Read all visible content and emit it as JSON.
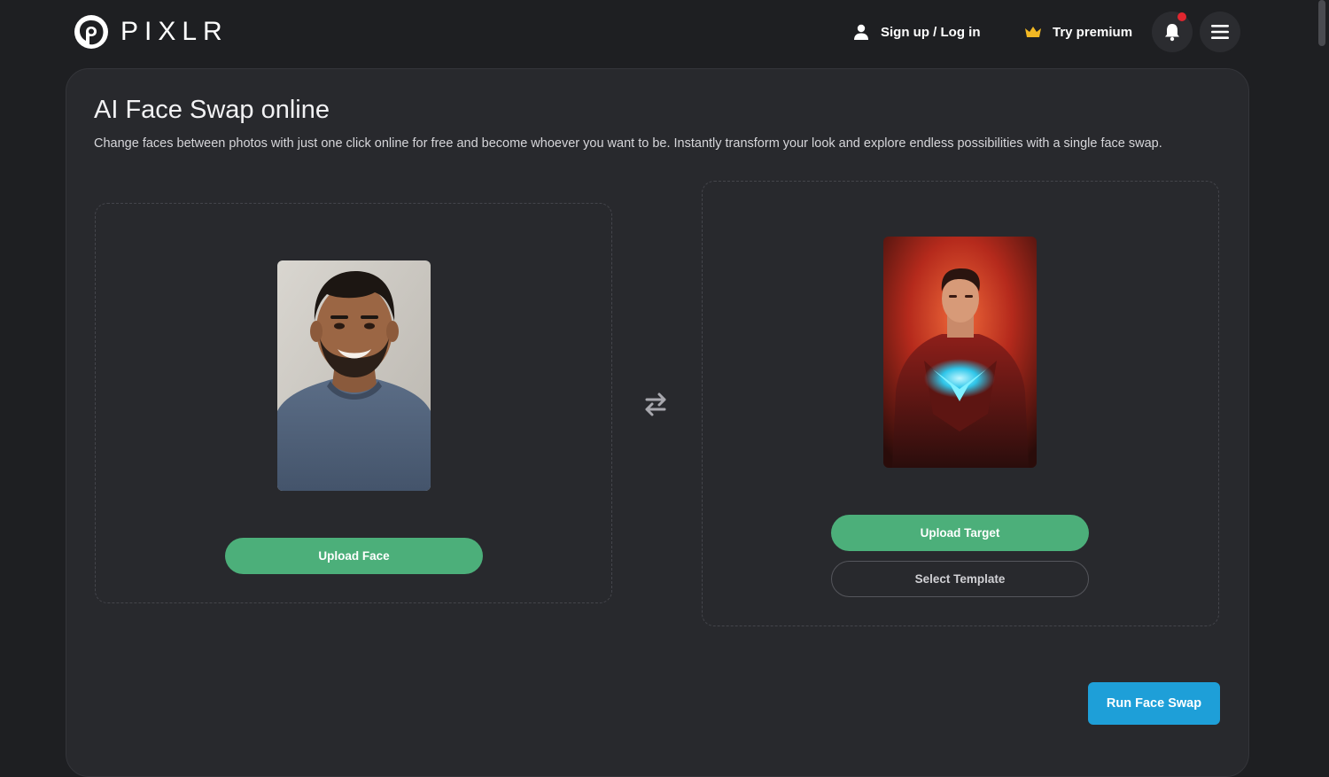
{
  "header": {
    "brand": "PIXLR",
    "signin_label": "Sign up / Log in",
    "premium_label": "Try premium",
    "icons": {
      "user": "user-icon",
      "crown": "crown-icon",
      "bell": "bell-icon",
      "menu": "hamburger-menu-icon"
    },
    "notification_dot": true
  },
  "main": {
    "title": "AI Face Swap online",
    "description": "Change faces between photos with just one click online for free and become whoever you want to be. Instantly transform your look and explore endless possibilities with a single face swap.",
    "face_panel": {
      "upload_label": "Upload Face"
    },
    "target_panel": {
      "upload_label": "Upload Target",
      "template_label": "Select Template"
    },
    "run_label": "Run Face Swap"
  },
  "colors": {
    "background": "#1e1f22",
    "panel": "#28292d",
    "accent_green": "#4caf7a",
    "accent_blue": "#1e9fd8",
    "premium_crown": "#f2b824",
    "notification": "#e0262f"
  }
}
